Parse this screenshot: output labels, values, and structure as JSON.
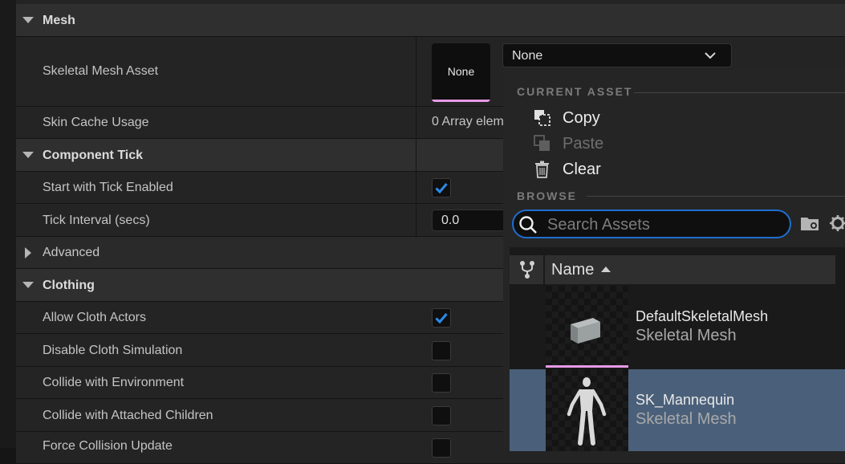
{
  "categories": {
    "mesh": "Mesh",
    "component_tick": "Component Tick",
    "advanced": "Advanced",
    "clothing": "Clothing"
  },
  "properties": {
    "skeletal_mesh_asset": "Skeletal Mesh Asset",
    "skin_cache_usage": "Skin Cache Usage",
    "start_with_tick_enabled": "Start with Tick Enabled",
    "tick_interval": "Tick Interval (secs)",
    "allow_cloth_actors": "Allow Cloth Actors",
    "disable_cloth_simulation": "Disable Cloth Simulation",
    "collide_with_environment": "Collide with Environment",
    "collide_with_attached_children": "Collide with Attached Children",
    "force_collision_update": "Force Collision Update"
  },
  "values": {
    "mesh_thumbnail_label": "None",
    "mesh_combo_value": "None",
    "skin_cache_array": "0 Array elem",
    "tick_interval_value": "0.0",
    "start_with_tick_enabled": true,
    "allow_cloth_actors": true,
    "disable_cloth_simulation": false,
    "collide_with_environment": false,
    "collide_with_attached_children": false,
    "force_collision_update": false
  },
  "picker": {
    "current_asset_header": "CURRENT ASSET",
    "copy": "Copy",
    "paste": "Paste",
    "clear": "Clear",
    "browse_header": "BROWSE",
    "search_placeholder": "Search Assets",
    "column_name": "Name",
    "assets": [
      {
        "name": "DefaultSkeletalMesh",
        "type": "Skeletal Mesh",
        "selected": false
      },
      {
        "name": "SK_Mannequin",
        "type": "Skeletal Mesh",
        "selected": true
      }
    ]
  },
  "colors": {
    "accent_blue": "#1e6ed0",
    "checkmark_blue": "#2c8dea",
    "asset_type_pink": "#e79ae6",
    "selection_bg": "#4a607a"
  }
}
